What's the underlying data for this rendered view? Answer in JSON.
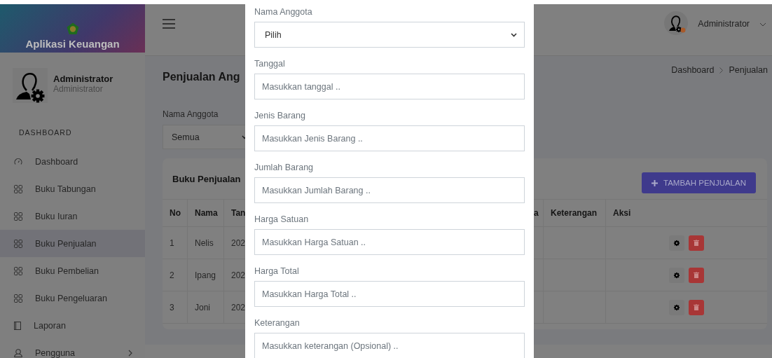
{
  "sidebar": {
    "brand": "Aplikasi Keuangan",
    "user": {
      "name": "Administrator",
      "role": "Administrator"
    },
    "section": "DASHBOARD",
    "items": [
      {
        "label": "Dashboard",
        "kind": "gauge",
        "selected": false
      },
      {
        "label": "Buku Tabungan",
        "kind": "grid",
        "selected": false
      },
      {
        "label": "Buku Iuran",
        "kind": "grid",
        "selected": false
      },
      {
        "label": "Buku Penjualan",
        "kind": "grid",
        "selected": true
      },
      {
        "label": "Buku Pembelian",
        "kind": "grid",
        "selected": false
      },
      {
        "label": "Buku Pengeluaran",
        "kind": "grid",
        "selected": false
      },
      {
        "label": "Laporan",
        "kind": "book",
        "selected": false
      },
      {
        "label": "Pengguna",
        "kind": "user",
        "selected": false,
        "has_submenu": true
      }
    ]
  },
  "topbar": {
    "user": "Administrator"
  },
  "page": {
    "title": "Penjualan Ang",
    "breadcrumb": [
      "Dashboard",
      "Penjualan"
    ],
    "filter": {
      "label": "Nama Anggota",
      "value": "Semua"
    }
  },
  "card": {
    "title": "Buku Penjualan",
    "add_button": "TAMBAH PENJUALAN",
    "left_columns": [
      "No",
      "Nama",
      "Tan"
    ],
    "right_columns": [
      "a",
      "Keterangan",
      "Aksi"
    ],
    "rows": [
      {
        "no": "1",
        "nama": "Nelis",
        "column_3": "202"
      },
      {
        "no": "2",
        "nama": "Ipang",
        "column_3": "202"
      },
      {
        "no": "3",
        "nama": "Joni",
        "column_3": "202"
      }
    ]
  },
  "modal": {
    "fields": [
      {
        "label": "Nama Anggota",
        "kind": "select",
        "value": "Pilih"
      },
      {
        "label": "Tanggal",
        "kind": "text",
        "placeholder": "Masukkan tanggal .."
      },
      {
        "label": "Jenis Barang",
        "kind": "text",
        "placeholder": "Masukkan Jenis Barang .."
      },
      {
        "label": "Jumlah Barang",
        "kind": "text",
        "placeholder": "Masukkan Jumlah Barang .."
      },
      {
        "label": "Harga Satuan",
        "kind": "text",
        "placeholder": "Masukkan Harga Satuan .."
      },
      {
        "label": "Harga Total",
        "kind": "text",
        "placeholder": "Masukkan Harga Total .."
      },
      {
        "label": "Keterangan",
        "kind": "textarea",
        "placeholder": "Masukkan keterangan (Opsional) .."
      }
    ]
  }
}
